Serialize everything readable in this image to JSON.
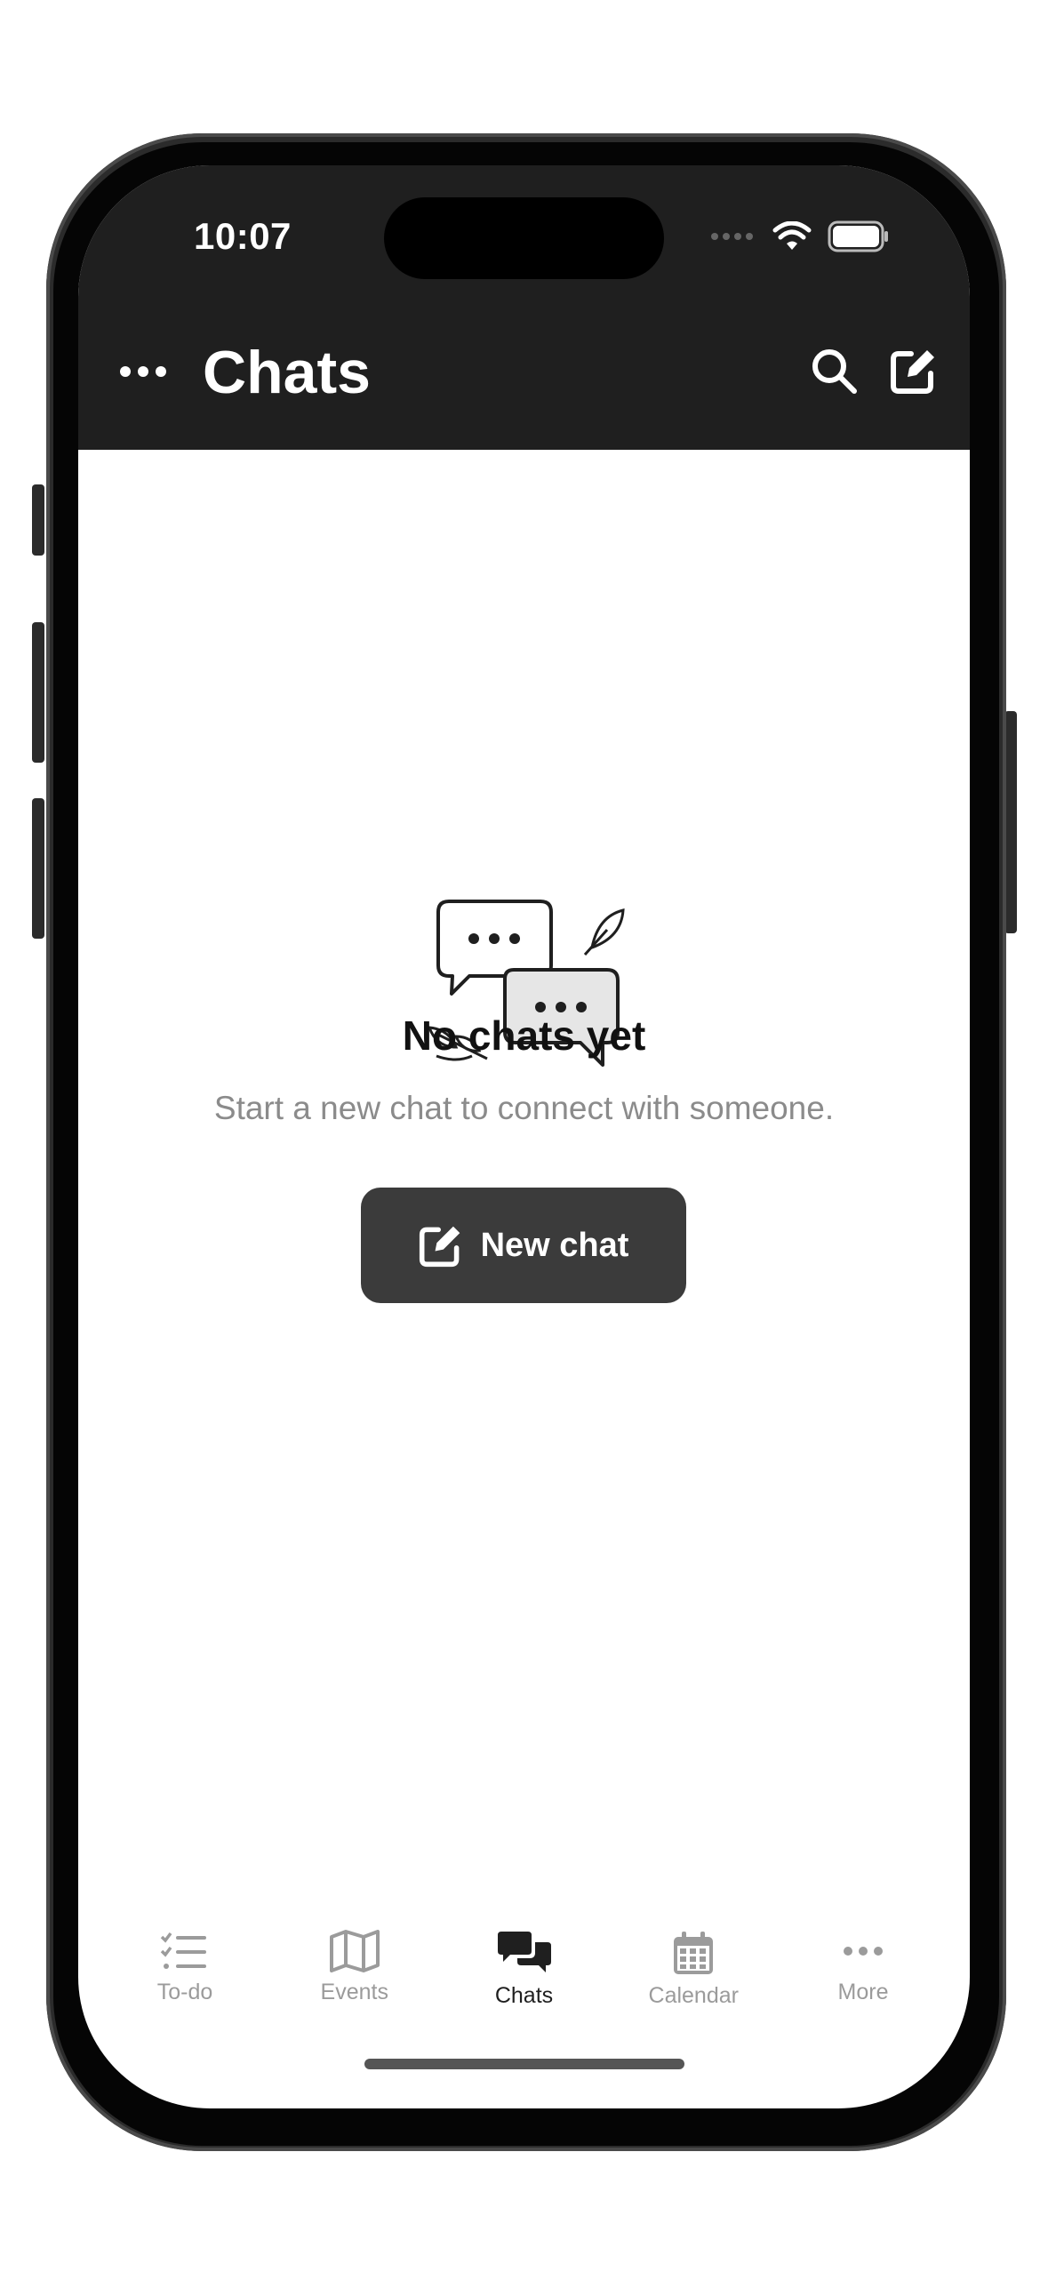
{
  "status_bar": {
    "time": "10:07"
  },
  "header": {
    "title": "Chats",
    "more_icon": "ellipsis-icon",
    "search_icon": "search-icon",
    "compose_icon": "compose-icon"
  },
  "empty_state": {
    "title": "No chats yet",
    "subtitle": "Start a new chat to connect with someone.",
    "button_label": "New chat"
  },
  "tabs": [
    {
      "label": "To-do",
      "icon": "todo-list-icon",
      "active": false
    },
    {
      "label": "Events",
      "icon": "map-icon",
      "active": false
    },
    {
      "label": "Chats",
      "icon": "chat-bubbles-icon",
      "active": true
    },
    {
      "label": "Calendar",
      "icon": "calendar-icon",
      "active": false
    },
    {
      "label": "More",
      "icon": "ellipsis-icon",
      "active": false
    }
  ],
  "colors": {
    "header_bg": "#1f1f1f",
    "button_bg": "#3b3b3b",
    "inactive_tab": "#9b9b9b",
    "subtitle": "#8b8b8b"
  }
}
